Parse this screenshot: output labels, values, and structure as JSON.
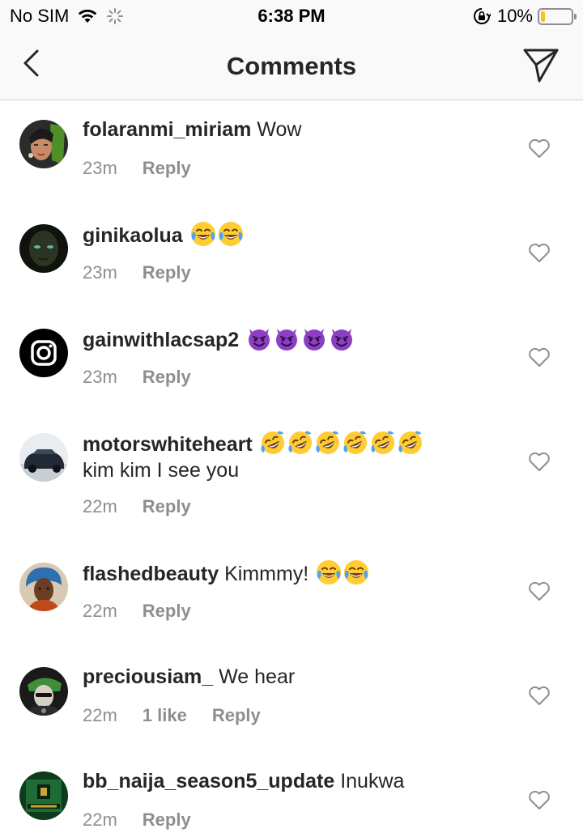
{
  "status_bar": {
    "carrier": "No SIM",
    "time": "6:38 PM",
    "battery": "10%"
  },
  "header": {
    "title": "Comments"
  },
  "comments": [
    {
      "username": "folaranmi_miriam",
      "text": "Wow",
      "emojis": [],
      "text2": "",
      "time": "23m",
      "likes": "",
      "reply": "Reply"
    },
    {
      "username": "ginikaolua",
      "text": "",
      "emojis": [
        "tears-of-joy",
        "tears-of-joy"
      ],
      "text2": "",
      "time": "23m",
      "likes": "",
      "reply": "Reply"
    },
    {
      "username": "gainwithlacsap2",
      "text": "",
      "emojis": [
        "smiling-devil",
        "smiling-devil",
        "smiling-devil",
        "smiling-devil"
      ],
      "text2": "",
      "time": "23m",
      "likes": "",
      "reply": "Reply"
    },
    {
      "username": "motorswhiteheart",
      "text": "",
      "emojis": [
        "rofl",
        "rofl",
        "rofl",
        "rofl",
        "rofl",
        "rofl"
      ],
      "text2": "kim kim I see you",
      "time": "22m",
      "likes": "",
      "reply": "Reply"
    },
    {
      "username": "flashedbeauty",
      "text": "Kimmmy!",
      "emojis": [
        "tears-of-joy",
        "tears-of-joy"
      ],
      "text2": "",
      "time": "22m",
      "likes": "",
      "reply": "Reply"
    },
    {
      "username": "preciousiam_",
      "text": "We hear",
      "emojis": [],
      "text2": "",
      "time": "22m",
      "likes": "1 like",
      "reply": "Reply"
    },
    {
      "username": "bb_naija_season5_update",
      "text": "Inukwa",
      "emojis": [],
      "text2": "",
      "time": "22m",
      "likes": "",
      "reply": "Reply"
    }
  ]
}
